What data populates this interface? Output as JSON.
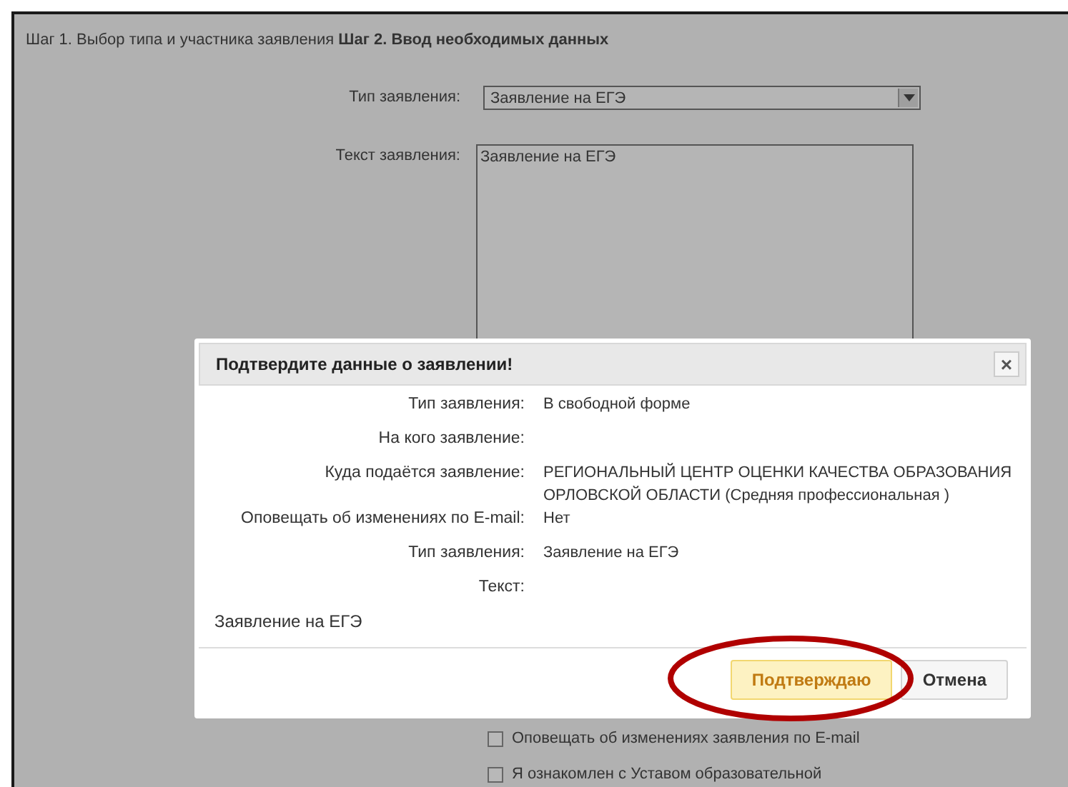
{
  "form": {
    "heading": {
      "step1": "Шаг 1. Выбор типа и участника заявления",
      "step2": "Шаг 2. Ввод необходимых данных"
    },
    "fields": [
      {
        "kind": "select",
        "label": "Тип заявления:",
        "value": "Заявление на ЕГЭ"
      },
      {
        "kind": "textarea",
        "label": "Текст заявления:",
        "value": "Заявление на ЕГЭ"
      }
    ],
    "checkboxes": [
      {
        "label": "Оповещать об изменениях заявления по E-mail",
        "checked": false
      },
      {
        "label": "Я ознакомлен с Уставом образовательной",
        "checked": false
      }
    ]
  },
  "dialog": {
    "title": "Подтвердите данные о заявлении!",
    "close": "×",
    "rows": [
      {
        "label": "Тип заявления:",
        "value": "В свободной форме"
      },
      {
        "label": "На кого заявление:",
        "value": ""
      },
      {
        "label": "Куда подаётся заявление:",
        "value": "РЕГИОНАЛЬНЫЙ ЦЕНТР ОЦЕНКИ КАЧЕСТВА ОБРАЗОВАНИЯ ОРЛОВСКОЙ ОБЛАСТИ (Средняя профессиональная )"
      },
      {
        "label": "Оповещать об изменениях по E-mail:",
        "value": "Нет"
      },
      {
        "label": "Тип заявления:",
        "value": "Заявление на ЕГЭ"
      },
      {
        "label": "Текст:",
        "value": ""
      }
    ],
    "text": "Заявление на ЕГЭ",
    "buttons": [
      {
        "kind": "primary",
        "label": "Подтверждаю"
      },
      {
        "kind": "secondary",
        "label": "Отмена"
      }
    ]
  }
}
